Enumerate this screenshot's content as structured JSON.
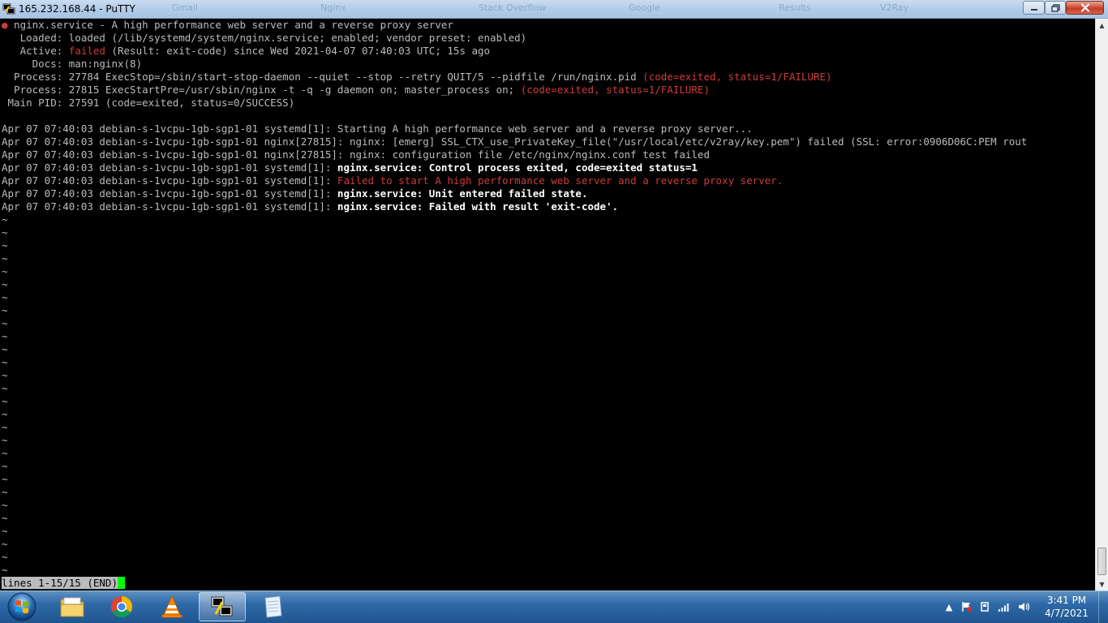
{
  "window": {
    "title": "165.232.168.44 - PuTTY",
    "icon": "putty-icon",
    "background_tabs": [
      "Gmail",
      "Nginx",
      "Stack Overflow",
      "Google",
      "Results",
      "V2Ray"
    ]
  },
  "terminal": {
    "bullet": "●",
    "header": {
      "unit": " nginx.service - A high performance web server and a reverse proxy server",
      "loaded": "   Loaded: loaded (/lib/systemd/system/nginx.service; enabled; vendor preset: enabled)",
      "active_prefix": "   Active: ",
      "active_state": "failed",
      "active_suffix": " (Result: exit-code) since Wed 2021-04-07 07:40:03 UTC; 15s ago",
      "docs": "     Docs: man:nginx(8)",
      "process1_text": "  Process: 27784 ExecStop=/sbin/start-stop-daemon --quiet --stop --retry QUIT/5 --pidfile /run/nginx.pid ",
      "process1_status": "(code=exited, status=1/FAILURE)",
      "process2_text": "  Process: 27815 ExecStartPre=/usr/sbin/nginx -t -q -g daemon on; master_process on; ",
      "process2_status": "(code=exited, status=1/FAILURE)",
      "main_pid": " Main PID: 27591 (code=exited, status=0/SUCCESS)"
    },
    "log": [
      {
        "prefix": "Apr 07 07:40:03 debian-s-1vcpu-1gb-sgp1-01 systemd[1]: ",
        "message": "Starting A high performance web server and a reverse proxy server...",
        "style": "normal"
      },
      {
        "prefix": "Apr 07 07:40:03 debian-s-1vcpu-1gb-sgp1-01 nginx[27815]: ",
        "message": "nginx: [emerg] SSL_CTX_use_PrivateKey_file(\"/usr/local/etc/v2ray/key.pem\") failed (SSL: error:0906D06C:PEM rout",
        "style": "normal"
      },
      {
        "prefix": "Apr 07 07:40:03 debian-s-1vcpu-1gb-sgp1-01 nginx[27815]: ",
        "message": "nginx: configuration file /etc/nginx/nginx.conf test failed",
        "style": "normal"
      },
      {
        "prefix": "Apr 07 07:40:03 debian-s-1vcpu-1gb-sgp1-01 systemd[1]: ",
        "message": "nginx.service: Control process exited, code=exited status=1",
        "style": "bright"
      },
      {
        "prefix": "Apr 07 07:40:03 debian-s-1vcpu-1gb-sgp1-01 systemd[1]: ",
        "message": "Failed to start A high performance web server and a reverse proxy server.",
        "style": "red"
      },
      {
        "prefix": "Apr 07 07:40:03 debian-s-1vcpu-1gb-sgp1-01 systemd[1]: ",
        "message": "nginx.service: Unit entered failed state.",
        "style": "bright"
      },
      {
        "prefix": "Apr 07 07:40:03 debian-s-1vcpu-1gb-sgp1-01 systemd[1]: ",
        "message": "nginx.service: Failed with result 'exit-code'.",
        "style": "bright"
      }
    ],
    "tilde": "~",
    "tilde_count": 28,
    "pager_status": "lines 1-15/15 (END)"
  },
  "taskbar": {
    "apps": [
      {
        "name": "explorer",
        "icon": "folder-icon",
        "active": false
      },
      {
        "name": "chrome",
        "icon": "chrome-icon",
        "active": false
      },
      {
        "name": "vlc",
        "icon": "vlc-icon",
        "active": false
      },
      {
        "name": "putty",
        "icon": "putty-icon",
        "active": true
      },
      {
        "name": "notepad",
        "icon": "notepad-icon",
        "active": false
      }
    ],
    "clock": {
      "time": "3:41 PM",
      "date": "4/7/2021"
    }
  },
  "colors": {
    "terminal_bg": "#000000",
    "terminal_fg": "#bbbbbb",
    "error_red": "#cd3c3c",
    "cursor_green": "#00ff00",
    "taskbar_blue": "#2f6aa8"
  }
}
